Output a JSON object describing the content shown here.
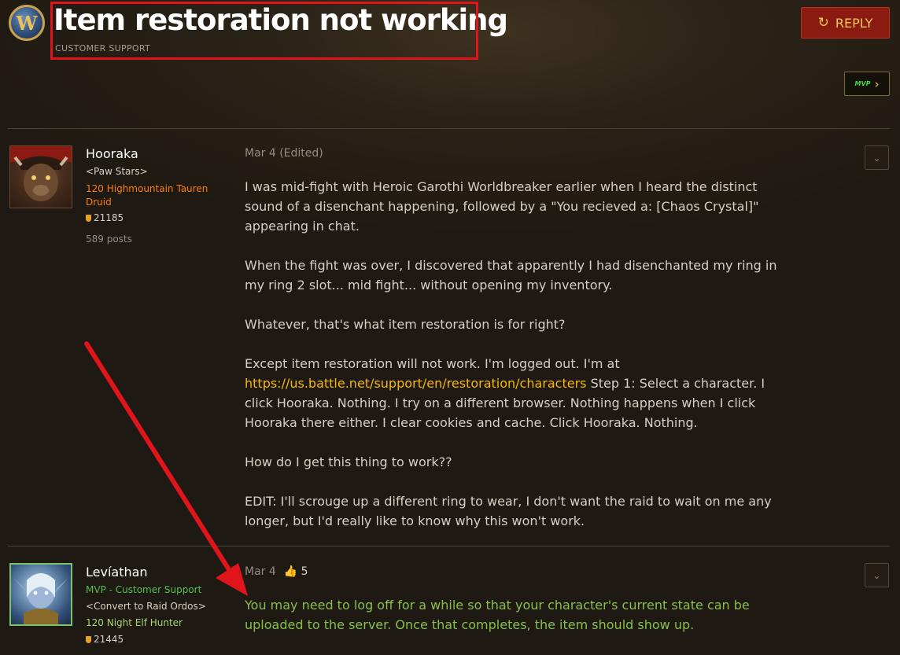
{
  "topic": {
    "title": "Item restoration not working",
    "category": "CUSTOMER SUPPORT"
  },
  "logo": {
    "glyph": "W"
  },
  "actions": {
    "reply_icon": "↻",
    "reply_label": "REPLY",
    "mvp_label": "MVP",
    "mvp_chevron": "›"
  },
  "posts": [
    {
      "username": "Hooraka",
      "guild": "<Paw Stars>",
      "class_line": "120 Highmountain Tauren Druid",
      "achievements": "21185",
      "post_count": "589 posts",
      "date": "Mar 4 (Edited)",
      "menu_icon": "⌄",
      "paragraphs": [
        "I was mid-fight with Heroic Garothi Worldbreaker earlier when I heard the distinct sound of a disenchant happening, followed by a \"You recieved a: [Chaos Crystal]\" appearing in chat.",
        "When the fight was over, I discovered that apparently I had disenchanted my ring in my ring 2 slot... mid fight... without opening my inventory.",
        "Whatever, that's what item restoration is for right?",
        "How do I get this thing to work??",
        "EDIT: I'll scrouge up a different ring to wear, I don't want the raid to wait on me any longer, but I'd really like to know why this won't work."
      ],
      "p4_before": "Except item restoration will not work. I'm logged out. I'm at ",
      "p4_link": "https://us.battle.net/support/en/restoration/characters",
      "p4_after": " Step 1: Select a character. I click Hooraka. Nothing. I try on a different browser. Nothing happens when I click Hooraka there either. I clear cookies and cache. Click Hooraka. Nothing."
    },
    {
      "username": "Levíathan",
      "title": "MVP - Customer Support",
      "guild": "<Convert to Raid Ordos>",
      "class_line": "120 Night Elf Hunter",
      "achievements": "21445",
      "date": "Mar 4",
      "like_icon": "👍",
      "likes": "5",
      "menu_icon": "⌄",
      "text": "You may need to log off for a while so that your character's current state can be uploaded to the server. Once that completes, the item should show up."
    }
  ],
  "colors": {
    "highlight_box": "#e0141b",
    "arrow": "#e0141b",
    "druid": "#ff7d0a",
    "hunter": "#abd473",
    "mvp": "#55c04a",
    "link": "#f8b700"
  }
}
